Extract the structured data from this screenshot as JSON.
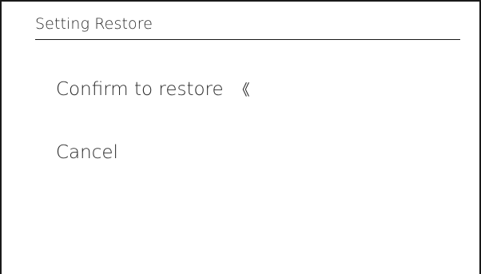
{
  "screen": {
    "title": "Setting Restore"
  },
  "menu": {
    "items": [
      {
        "label": "Confirm to restore",
        "selected": true
      },
      {
        "label": "Cancel",
        "selected": false
      }
    ],
    "selector_glyph": "《"
  }
}
